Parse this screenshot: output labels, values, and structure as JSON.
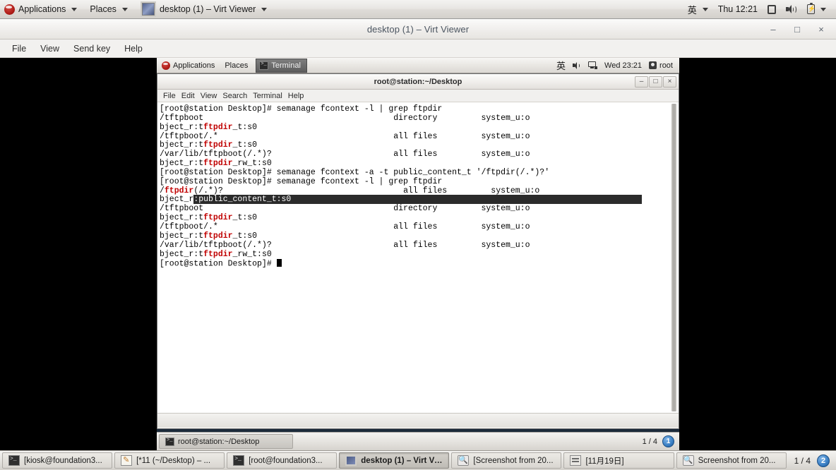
{
  "host": {
    "top_panel": {
      "applications_label": "Applications",
      "places_label": "Places",
      "window_menu_label": "desktop (1) – Virt Viewer",
      "ime_label": "英",
      "clock": "Thu 12:21",
      "icons": [
        "redhat-logo-icon",
        "screen-icon",
        "volume-icon",
        "battery-icon"
      ]
    },
    "taskbar": {
      "items": [
        {
          "label": "[kiosk@foundation3...",
          "icon": "terminal-icon",
          "active": false
        },
        {
          "label": "[*11 (~/Desktop) – ...",
          "icon": "editor-icon",
          "active": false
        },
        {
          "label": "[root@foundation3...",
          "icon": "terminal-icon",
          "active": false
        },
        {
          "label": "desktop (1) – Virt Vi...",
          "icon": "monitor-icon",
          "active": true
        },
        {
          "label": "[Screenshot from 20...",
          "icon": "screenshot-icon",
          "active": false
        },
        {
          "label": "[11月19日]",
          "icon": "archive-icon",
          "active": false
        },
        {
          "label": "Screenshot from 20...",
          "icon": "screenshot-icon",
          "active": false
        }
      ],
      "workspace_count": "1 / 4",
      "workspace_badge": "2"
    }
  },
  "virt_viewer": {
    "title": "desktop (1) – Virt Viewer",
    "window_buttons": {
      "minimize": "–",
      "maximize": "□",
      "close": "×"
    },
    "menus": [
      "File",
      "View",
      "Send key",
      "Help"
    ]
  },
  "guest": {
    "top_panel": {
      "applications_label": "Applications",
      "places_label": "Places",
      "active_window_label": "Terminal",
      "ime_label": "英",
      "clock": "Wed 23:21",
      "user_label": "root",
      "icons": [
        "redhat-logo-icon",
        "volume-icon",
        "network-icon",
        "user-icon"
      ]
    },
    "terminal": {
      "title": "root@station:~/Desktop",
      "menus": [
        "File",
        "Edit",
        "View",
        "Search",
        "Terminal",
        "Help"
      ],
      "window_buttons": {
        "minimize": "–",
        "maximize": "□",
        "close": "×"
      },
      "prompt": "[root@station Desktop]# ",
      "lines": [
        {
          "type": "prompt",
          "text": "[root@station Desktop]# semanage fcontext -l | grep ftpdir"
        },
        {
          "type": "plain",
          "text": "/tftpboot                                       directory         system_u:o"
        },
        {
          "type": "match",
          "pre": "bject_r:t",
          "match": "ftpdir",
          "post": "_t:s0"
        },
        {
          "type": "plain",
          "text": "/tftpboot/.*                                    all files         system_u:o"
        },
        {
          "type": "match",
          "pre": "bject_r:t",
          "match": "ftpdir",
          "post": "_t:s0"
        },
        {
          "type": "plain",
          "text": "/var/lib/tftpboot(/.*)?                         all files         system_u:o"
        },
        {
          "type": "match",
          "pre": "bject_r:t",
          "match": "ftpdir",
          "post": "_rw_t:s0"
        },
        {
          "type": "prompt",
          "text": "[root@station Desktop]# semanage fcontext -a -t public_content_t '/ftpdir(/.*)?'"
        },
        {
          "type": "prompt",
          "text": "[root@station Desktop]# semanage fcontext -l | grep ftpdir"
        },
        {
          "type": "match-lead",
          "pre": "/",
          "match": "ftpdir",
          "post": "(/.*)?                                     all files         system_u:o"
        },
        {
          "type": "selected",
          "pre": "bject_r",
          "sel": ":public_content_t:s0"
        },
        {
          "type": "plain",
          "text": "/tftpboot                                       directory         system_u:o"
        },
        {
          "type": "match",
          "pre": "bject_r:t",
          "match": "ftpdir",
          "post": "_t:s0"
        },
        {
          "type": "plain",
          "text": "/tftpboot/.*                                    all files         system_u:o"
        },
        {
          "type": "match",
          "pre": "bject_r:t",
          "match": "ftpdir",
          "post": "_t:s0"
        },
        {
          "type": "plain",
          "text": "/var/lib/tftpboot(/.*)?                         all files         system_u:o"
        },
        {
          "type": "match",
          "pre": "bject_r:t",
          "match": "ftpdir",
          "post": "_rw_t:s0"
        },
        {
          "type": "cursor",
          "text": "[root@station Desktop]# "
        }
      ],
      "colors": {
        "grep_match": "#c00000",
        "selection_bg": "#2b2b2b",
        "selection_fg": "#ffffff"
      }
    },
    "bottom_panel": {
      "task_label": "root@station:~/Desktop",
      "task_icon": "terminal-icon",
      "workspace_count": "1 / 4",
      "workspace_badge": "1"
    }
  }
}
